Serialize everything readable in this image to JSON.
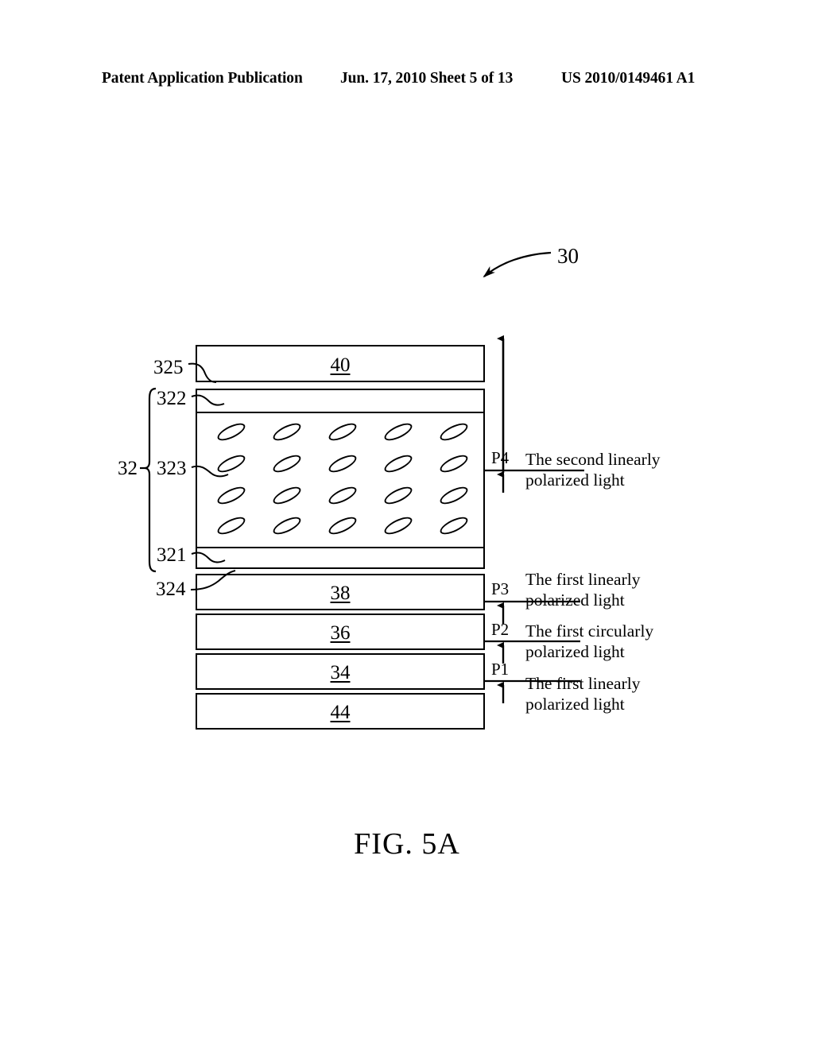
{
  "header": {
    "publication": "Patent Application Publication",
    "date_sheet": "Jun. 17, 2010  Sheet 5 of 13",
    "patent_number": "US 2010/0149461 A1"
  },
  "figure": {
    "caption": "FIG. 5A",
    "assembly_ref": "30",
    "group_ref": "32",
    "layers": [
      {
        "id": "layer-40",
        "number": "40"
      },
      {
        "id": "layer-38",
        "number": "38"
      },
      {
        "id": "layer-36",
        "number": "36"
      },
      {
        "id": "layer-34",
        "number": "34"
      },
      {
        "id": "layer-44",
        "number": "44"
      }
    ],
    "cell_refs": [
      {
        "id": "ref-325",
        "label": "325"
      },
      {
        "id": "ref-322",
        "label": "322"
      },
      {
        "id": "ref-323",
        "label": "323"
      },
      {
        "id": "ref-321",
        "label": "321"
      },
      {
        "id": "ref-324",
        "label": "324"
      }
    ],
    "light_paths": [
      {
        "id": "p4",
        "label": "P4",
        "line1": "The second linearly",
        "line2": "polarized light"
      },
      {
        "id": "p3",
        "label": "P3",
        "line1": "The first linearly",
        "line2": "polarized light"
      },
      {
        "id": "p2",
        "label": "P2",
        "line1": "The first circularly",
        "line2": "polarized light"
      },
      {
        "id": "p1",
        "label": "P1",
        "line1": "The first linearly",
        "line2": "polarized light"
      }
    ]
  },
  "style": {
    "ink": "#000000",
    "paper": "#ffffff"
  }
}
